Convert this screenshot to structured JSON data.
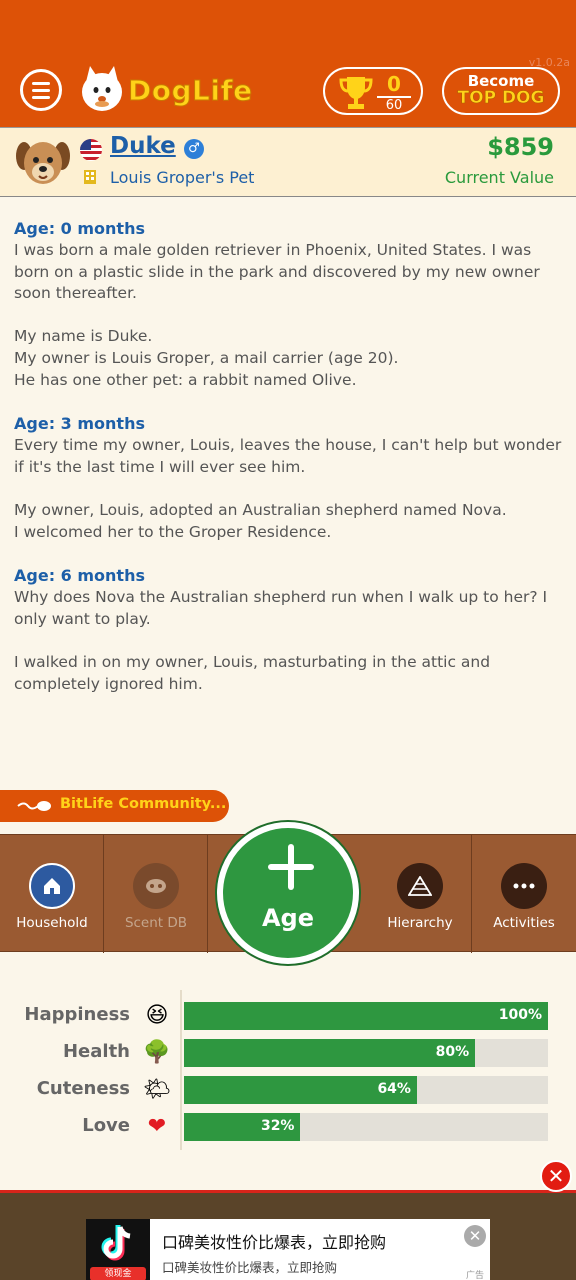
{
  "header": {
    "version": "v1.0.2a",
    "logo_text": "DogLife",
    "trophy": {
      "count": "0",
      "total": "60"
    },
    "become": {
      "line1": "Become",
      "line2": "TOP DOG"
    }
  },
  "pet": {
    "name": "Duke",
    "owner_line": "Louis Groper's Pet",
    "value": "$859",
    "value_label": "Current Value"
  },
  "story": [
    {
      "age": "Age: 0 months",
      "paragraphs": [
        "I was born a male golden retriever in Phoenix, United States. I was born on a plastic slide in the park and discovered by my new owner soon thereafter.",
        "My name is Duke.\nMy owner is Louis Groper, a mail carrier (age 20).\nHe has one other pet: a rabbit named Olive."
      ]
    },
    {
      "age": "Age: 3 months",
      "paragraphs": [
        "Every time my owner, Louis, leaves the house, I can't help but wonder if it's the last time I will ever see him.",
        "My owner, Louis, adopted an Australian shepherd named Nova.\nI welcomed her to the Groper Residence."
      ]
    },
    {
      "age": "Age: 6 months",
      "paragraphs": [
        "Why does Nova the Australian shepherd run when I walk up to her? I only want to play.",
        "I walked in on my owner, Louis, masturbating in the attic and completely ignored him."
      ]
    }
  ],
  "community": {
    "label": "BitLife Community..."
  },
  "nav": {
    "household": "Household",
    "scent_db": "Scent DB",
    "age": "Age",
    "hierarchy": "Hierarchy",
    "activities": "Activities"
  },
  "stats": [
    {
      "label": "Happiness",
      "emoji": "😆",
      "percent": 100,
      "text": "100%"
    },
    {
      "label": "Health",
      "emoji": "🌳",
      "percent": 80,
      "text": "80%"
    },
    {
      "label": "Cuteness",
      "emoji": "🌤",
      "percent": 64,
      "text": "64%"
    },
    {
      "label": "Love",
      "emoji": "❤",
      "percent": 32,
      "text": "32%"
    }
  ],
  "ad": {
    "title": "口碑美妆性价比爆表，立即抢购",
    "subtitle": "口碑美妆性价比爆表，立即抢购",
    "badge": "领现金",
    "tag": "广告"
  },
  "colors": {
    "header": "#dd5207",
    "accent_yellow": "#ffd319",
    "link_blue": "#1d5fa8",
    "money_green": "#2a9a3c",
    "bar_green": "#2e9740",
    "nav_brown": "#9a5a32"
  }
}
